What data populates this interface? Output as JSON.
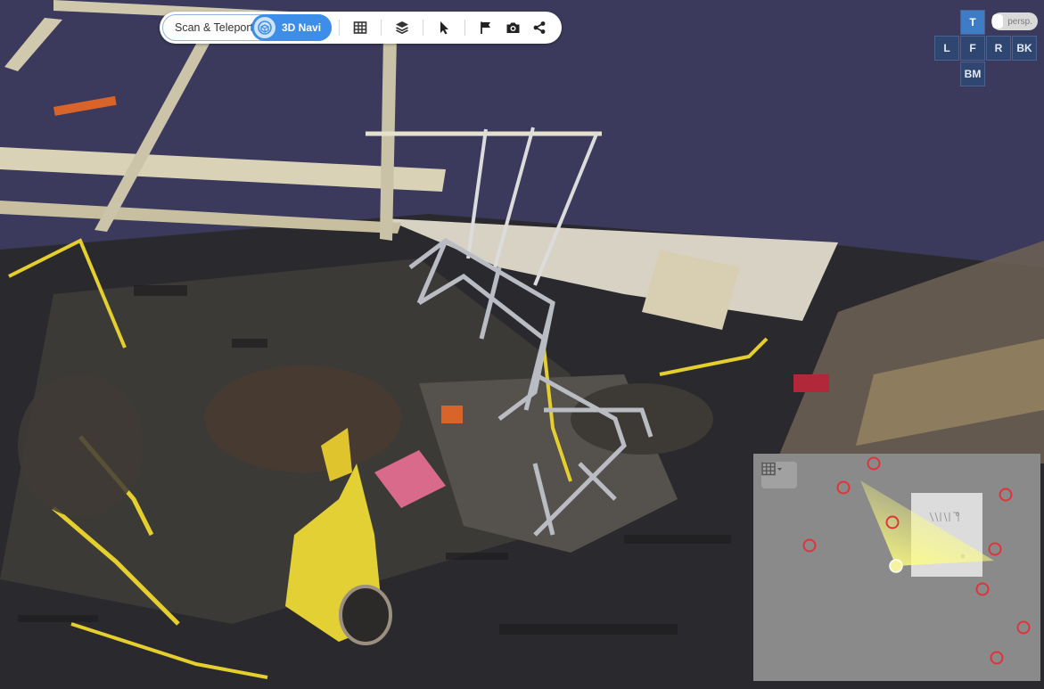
{
  "toolbar": {
    "mode_scan_label": "Scan & Teleport",
    "mode_navi_label": "3D Navi",
    "active_mode": "3D Navi",
    "tools": [
      "floorplan-grid",
      "layers",
      "select-pointer",
      "flag",
      "camera",
      "share"
    ]
  },
  "view_cube": {
    "top": "T",
    "left": "L",
    "front": "F",
    "right": "R",
    "back": "BK",
    "bottom": "BM",
    "active": "T",
    "persp_label": "persp."
  },
  "minimap": {
    "layer_button_icon": "grid-icon",
    "scan_point_count": 9,
    "current_position_color": "#f6f3a0",
    "scan_point_color": "#e0333a"
  },
  "colors": {
    "accent": "#3d8ee8",
    "scene_background": "#3b3a5c",
    "view_cube_tile": "#2f4670",
    "view_cube_active": "#3f7cc6"
  }
}
